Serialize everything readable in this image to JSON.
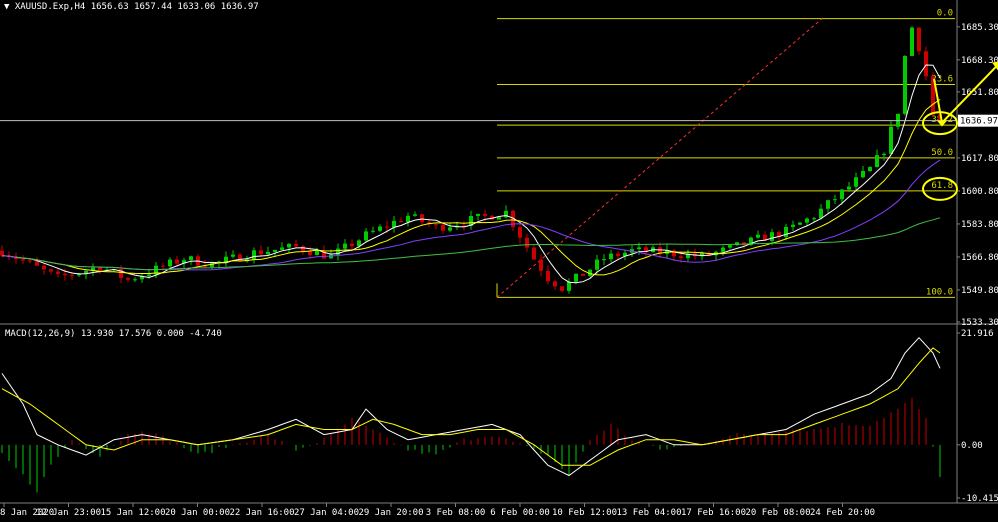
{
  "header": {
    "symbol": "XAUUSD.Exp,H4",
    "ohlc": "1656.63 1657.44 1633.06 1636.97"
  },
  "macd_header": {
    "label": "MACD(12,26,9)",
    "values": "13.930 17.576 0.000 -4.740"
  },
  "colors": {
    "background": "#000000",
    "bull_candle": "#00cc00",
    "bear_candle": "#cc0000",
    "fib_lines": "#d8d800",
    "trend_line": "#ff3030",
    "ma_fast": "#ffffff",
    "ma_mid": "#ffff00",
    "ma_slow_1": "#8040ff",
    "ma_slow_2": "#40c040",
    "annotation": "#ffff00",
    "bid_line": "#c0c0c0"
  },
  "chart_data": [
    {
      "type": "candlestick",
      "title": "XAUUSD.Exp,H4",
      "y_ticks": [
        "1685.30",
        "1668.30",
        "1651.80",
        "1617.80",
        "1600.80",
        "1583.80",
        "1566.80",
        "1549.80",
        "1533.30"
      ],
      "ylim": [
        1533.3,
        1695.0
      ],
      "current_price": "1636.97",
      "x_ticks": [
        "8 Jan 2020",
        "12 Jan 23:00",
        "15 Jan 12:00",
        "20 Jan 00:00",
        "22 Jan 16:00",
        "27 Jan 04:00",
        "29 Jan 20:00",
        "3 Feb 08:00",
        "6 Feb 00:00",
        "10 Feb 12:00",
        "13 Feb 04:00",
        "17 Feb 16:00",
        "20 Feb 08:00",
        "24 Feb 20:00"
      ],
      "fibonacci": [
        {
          "level": "0.0",
          "price": 1689.5
        },
        {
          "level": "23.6",
          "price": 1655.6
        },
        {
          "level": "38.2",
          "price": 1634.7
        },
        {
          "level": "50.0",
          "price": 1617.8
        },
        {
          "level": "61.8",
          "price": 1600.8
        },
        {
          "level": "100.0",
          "price": 1546.0
        }
      ],
      "highlighted_levels": [
        "38.2",
        "61.8"
      ],
      "price_path": [
        [
          0,
          1570
        ],
        [
          8,
          1556
        ],
        [
          14,
          1562
        ],
        [
          18,
          1555
        ],
        [
          26,
          1566
        ],
        [
          30,
          1563
        ],
        [
          36,
          1569
        ],
        [
          42,
          1572
        ],
        [
          47,
          1567
        ],
        [
          52,
          1578
        ],
        [
          58,
          1588
        ],
        [
          62,
          1582
        ],
        [
          66,
          1585
        ],
        [
          72,
          1590
        ],
        [
          76,
          1566
        ],
        [
          78,
          1556
        ],
        [
          80,
          1551
        ],
        [
          83,
          1558
        ],
        [
          86,
          1566
        ],
        [
          90,
          1570
        ],
        [
          95,
          1569
        ],
        [
          100,
          1567
        ],
        [
          104,
          1571
        ],
        [
          108,
          1576
        ],
        [
          112,
          1580
        ],
        [
          116,
          1588
        ],
        [
          120,
          1600
        ],
        [
          124,
          1612
        ],
        [
          126,
          1622
        ],
        [
          128,
          1642
        ],
        [
          129,
          1670
        ],
        [
          130,
          1685
        ],
        [
          131,
          1675
        ],
        [
          132,
          1660
        ],
        [
          133,
          1640
        ],
        [
          134,
          1637
        ]
      ]
    },
    {
      "type": "macd",
      "title": "MACD(12,26,9)",
      "y_ticks": [
        "21.916",
        "0.00",
        "-10.415"
      ],
      "ylim": [
        -10.415,
        21.916
      ],
      "histogram_path": [
        [
          0,
          -2
        ],
        [
          3,
          -6
        ],
        [
          5,
          -9
        ],
        [
          7,
          -4
        ],
        [
          10,
          1
        ],
        [
          14,
          -2
        ],
        [
          18,
          2
        ],
        [
          20,
          3
        ],
        [
          24,
          1
        ],
        [
          28,
          -2
        ],
        [
          33,
          0
        ],
        [
          38,
          2
        ],
        [
          42,
          -1
        ],
        [
          46,
          1
        ],
        [
          50,
          5
        ],
        [
          54,
          2
        ],
        [
          58,
          -1
        ],
        [
          62,
          -2
        ],
        [
          66,
          1
        ],
        [
          70,
          2
        ],
        [
          74,
          0
        ],
        [
          78,
          -2
        ],
        [
          81,
          -6
        ],
        [
          84,
          1
        ],
        [
          87,
          4
        ],
        [
          90,
          1
        ],
        [
          94,
          -1
        ],
        [
          98,
          0
        ],
        [
          102,
          1
        ],
        [
          105,
          2
        ],
        [
          108,
          2
        ],
        [
          112,
          3
        ],
        [
          116,
          3
        ],
        [
          120,
          4
        ],
        [
          124,
          4
        ],
        [
          128,
          7
        ],
        [
          130,
          9
        ],
        [
          132,
          5
        ],
        [
          134,
          -6
        ]
      ],
      "macd_path": [
        [
          0,
          14
        ],
        [
          3,
          8
        ],
        [
          5,
          2
        ],
        [
          8,
          0
        ],
        [
          12,
          -2
        ],
        [
          16,
          1
        ],
        [
          20,
          2
        ],
        [
          24,
          1
        ],
        [
          28,
          0
        ],
        [
          33,
          1
        ],
        [
          38,
          3
        ],
        [
          42,
          5
        ],
        [
          46,
          2
        ],
        [
          50,
          3
        ],
        [
          52,
          7
        ],
        [
          55,
          3
        ],
        [
          58,
          1
        ],
        [
          62,
          2
        ],
        [
          66,
          3
        ],
        [
          70,
          4
        ],
        [
          74,
          2
        ],
        [
          78,
          -4
        ],
        [
          81,
          -6
        ],
        [
          84,
          -3
        ],
        [
          88,
          1
        ],
        [
          92,
          2
        ],
        [
          96,
          0
        ],
        [
          100,
          0
        ],
        [
          104,
          1
        ],
        [
          108,
          2
        ],
        [
          112,
          3
        ],
        [
          116,
          6
        ],
        [
          120,
          8
        ],
        [
          124,
          10
        ],
        [
          127,
          13
        ],
        [
          129,
          18
        ],
        [
          131,
          21
        ],
        [
          133,
          18
        ],
        [
          134,
          15
        ]
      ],
      "signal_path": [
        [
          0,
          11
        ],
        [
          4,
          8
        ],
        [
          8,
          4
        ],
        [
          12,
          0
        ],
        [
          16,
          -1
        ],
        [
          20,
          1
        ],
        [
          24,
          1
        ],
        [
          28,
          0
        ],
        [
          33,
          1
        ],
        [
          38,
          2
        ],
        [
          42,
          4
        ],
        [
          46,
          3
        ],
        [
          50,
          3
        ],
        [
          53,
          5
        ],
        [
          56,
          4
        ],
        [
          60,
          2
        ],
        [
          64,
          2
        ],
        [
          68,
          3
        ],
        [
          72,
          3
        ],
        [
          76,
          0
        ],
        [
          80,
          -4
        ],
        [
          84,
          -4
        ],
        [
          88,
          -1
        ],
        [
          92,
          1
        ],
        [
          96,
          1
        ],
        [
          100,
          0
        ],
        [
          104,
          1
        ],
        [
          108,
          2
        ],
        [
          112,
          2
        ],
        [
          116,
          4
        ],
        [
          120,
          6
        ],
        [
          124,
          8
        ],
        [
          128,
          11
        ],
        [
          131,
          16
        ],
        [
          133,
          19
        ],
        [
          134,
          18
        ]
      ]
    }
  ]
}
